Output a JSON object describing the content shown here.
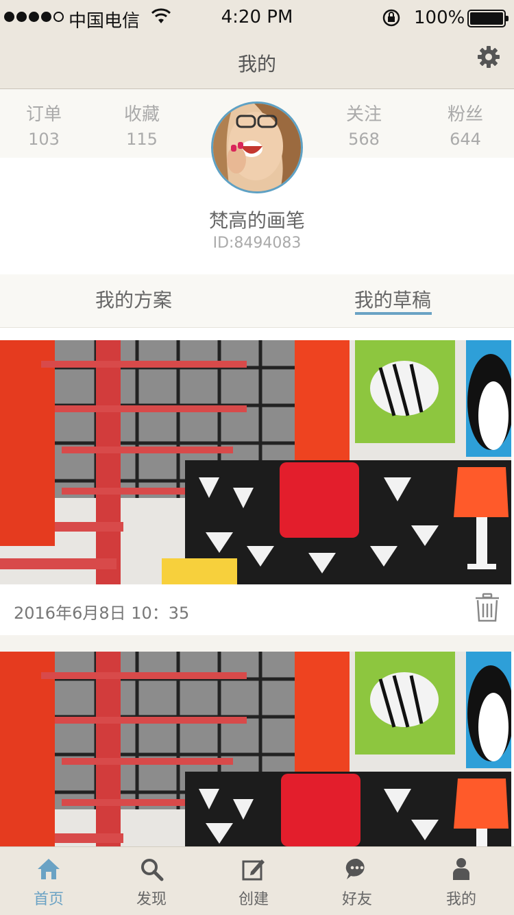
{
  "status_bar": {
    "carrier": "中国电信",
    "time": "4:20 PM",
    "battery": "100%"
  },
  "nav": {
    "title": "我的",
    "settings_icon": "gear-icon"
  },
  "profile": {
    "stats": [
      {
        "label": "订单",
        "value": "103"
      },
      {
        "label": "收藏",
        "value": "115"
      },
      {
        "label": "关注",
        "value": "568"
      },
      {
        "label": "粉丝",
        "value": "644"
      }
    ],
    "name": "梵高的画笔",
    "id": "ID:8494083"
  },
  "tabs": [
    {
      "label": "我的方案",
      "active": false
    },
    {
      "label": "我的草稿",
      "active": true
    }
  ],
  "drafts": [
    {
      "date": "2016年6月8日  10：35",
      "icon": "trash-icon"
    }
  ],
  "tabbar": [
    {
      "label": "首页",
      "icon": "home-icon",
      "active": true
    },
    {
      "label": "发现",
      "icon": "search-icon",
      "active": false
    },
    {
      "label": "创建",
      "icon": "edit-icon",
      "active": false
    },
    {
      "label": "好友",
      "icon": "chat-icon",
      "active": false
    },
    {
      "label": "我的",
      "icon": "person-icon",
      "active": false
    }
  ],
  "colors": {
    "accent": "#6aa2c4",
    "bar_bg": "#ece7de",
    "muted_text": "#aaaaaa"
  }
}
